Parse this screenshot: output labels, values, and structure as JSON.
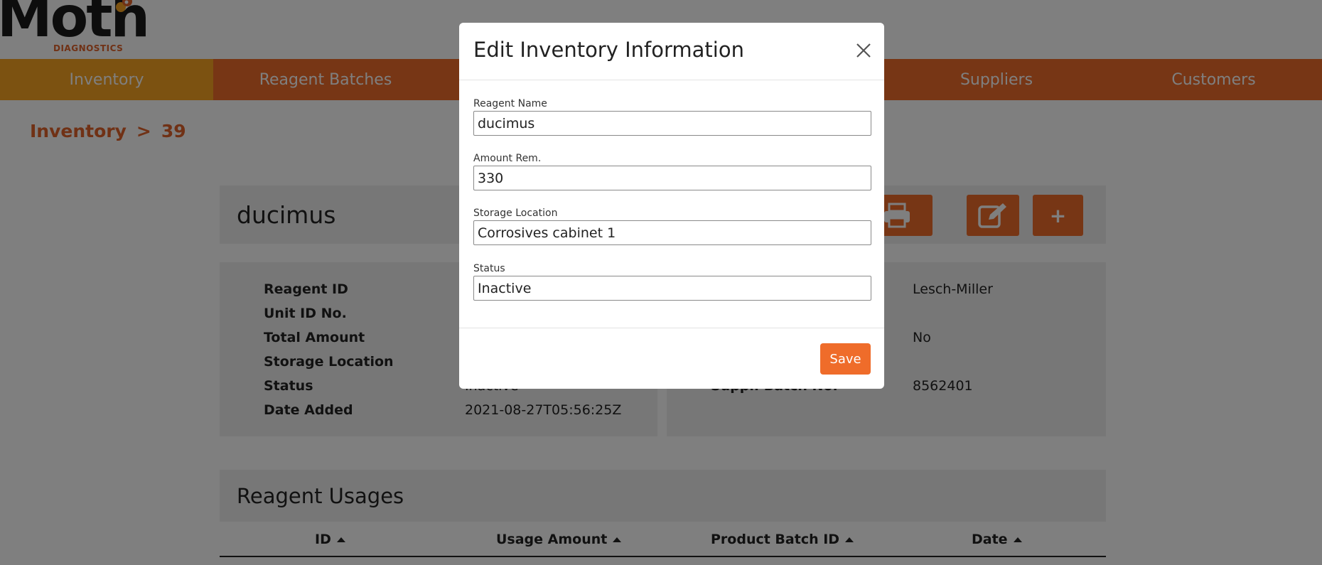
{
  "brand": {
    "name": "Moth",
    "tagline": "DIAGNOSTICS",
    "accent": "#ef6c2a",
    "active_nav": "#f8a423"
  },
  "nav": {
    "items": [
      "Inventory",
      "Reagent Batches",
      "Suppliers",
      "Customers"
    ]
  },
  "breadcrumb": {
    "root": "Inventory",
    "separator": ">",
    "current": "39"
  },
  "item": {
    "title": "ducimus"
  },
  "details_left": {
    "labels": [
      "Reagent ID",
      "Unit ID No.",
      "Total Amount",
      "Storage Location",
      "Status",
      "Date Added"
    ],
    "visible_values": {
      "status": "Inactive",
      "date_added": "2021-08-27T05:56:25Z"
    }
  },
  "details_right": {
    "visible_values": {
      "supplier": "Lesch-Miller",
      "flag": "No",
      "batch_no": "8562401"
    },
    "partial_label": "Suppl. Batch No."
  },
  "usages": {
    "title": "Reagent Usages",
    "columns": [
      "ID",
      "Usage Amount",
      "Product Batch ID",
      "Date"
    ]
  },
  "modal": {
    "title": "Edit Inventory Information",
    "fields": [
      {
        "label": "Reagent Name",
        "value": "ducimus"
      },
      {
        "label": "Amount Rem.",
        "value": "330"
      },
      {
        "label": "Storage Location",
        "value": "Corrosives cabinet 1"
      },
      {
        "label": "Status",
        "value": "Inactive"
      }
    ],
    "save_label": "Save"
  },
  "icons": {
    "print": "print-icon",
    "edit": "edit-icon",
    "add": "+",
    "close": "close-icon"
  }
}
